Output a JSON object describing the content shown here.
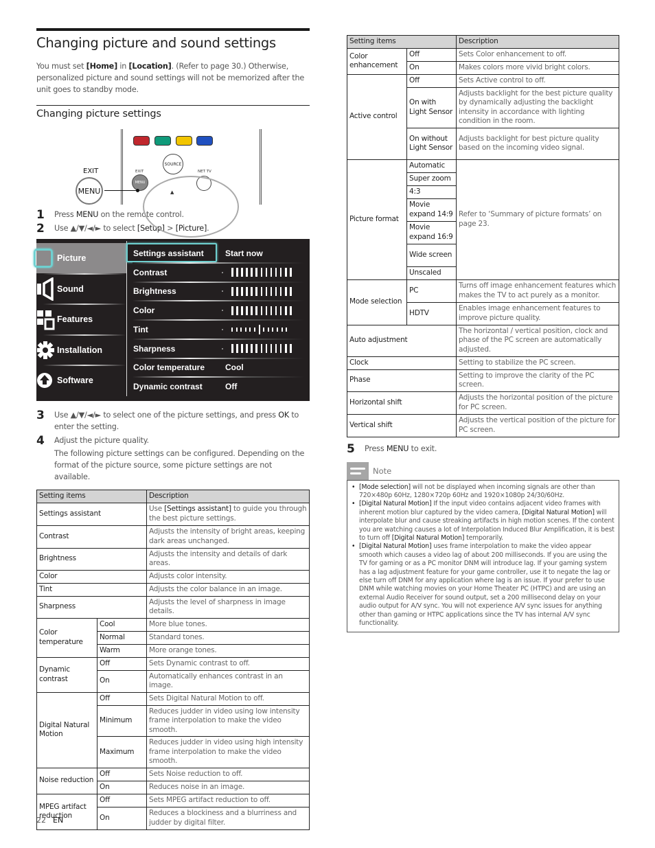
{
  "page": {
    "title": "Changing picture and sound settings",
    "intro": {
      "p1": "You must set ",
      "home": "[Home]",
      "p2": " in ",
      "location": "[Location]",
      "p3": ". (Refer to page 30.) Otherwise, personalized picture and sound settings will not be memorized after the unit goes to standby mode."
    },
    "subtitle": "Changing picture settings"
  },
  "remote": {
    "exit_label": "EXIT",
    "menu_label": "MENU",
    "source_label": "SOURCE",
    "net_tv_label": "NET TV",
    "small_exit_label": "EXIT",
    "small_menu_label": "MENU",
    "up_arrow": "▲",
    "color_buttons": [
      "#c0272d",
      "#0f9a7a",
      "#f2c500",
      "#2050c0"
    ]
  },
  "steps": [
    {
      "num": "1",
      "t1": "Press ",
      "k1": "MENU",
      "t2": " on the remote control."
    },
    {
      "num": "2",
      "t1": "Use ▲/▼/◄/► to select ",
      "k1": "[Setup]",
      "t2": " > ",
      "k2": "[Picture]",
      "t3": "."
    },
    {
      "num": "3",
      "t1": "Use ▲/▼/◄/► to select one of the picture settings, and press ",
      "k1": "OK",
      "t2": " to enter the setting."
    },
    {
      "num": "4",
      "t1": "Adjust the picture quality.",
      "t2": "The following picture settings can be configured. Depending on the format of the picture source, some picture settings are not available."
    },
    {
      "num": "5",
      "t1": "Press ",
      "k1": "MENU",
      "t2": " to exit."
    }
  ],
  "tv_menu": {
    "colors": {
      "background": "#231f20",
      "active": "#8c8a8b",
      "highlight": "#6fd0d0"
    },
    "categories": [
      {
        "label": "Picture",
        "icon": "picture-icon",
        "active": true
      },
      {
        "label": "Sound",
        "icon": "speaker-icon",
        "active": false
      },
      {
        "label": "Features",
        "icon": "features-icon",
        "active": false
      },
      {
        "label": "Installation",
        "icon": "gear-icon",
        "active": false
      },
      {
        "label": "Software",
        "icon": "upload-icon",
        "active": false
      }
    ],
    "items": [
      {
        "label": "Settings assistant",
        "value": "Start now",
        "type": "text"
      },
      {
        "label": "Contrast",
        "type": "slider",
        "level": 1.0
      },
      {
        "label": "Brightness",
        "type": "slider",
        "level": 1.0
      },
      {
        "label": "Color",
        "type": "slider",
        "level": 1.0
      },
      {
        "label": "Tint",
        "type": "tint",
        "level": 0.5
      },
      {
        "label": "Sharpness",
        "type": "slider",
        "level": 1.0
      },
      {
        "label": "Color temperature",
        "value": "Cool",
        "type": "text"
      },
      {
        "label": "Dynamic contrast",
        "value": "Off",
        "type": "text"
      }
    ]
  },
  "table1": {
    "headers": [
      "Setting items",
      "Description"
    ],
    "simple_rows": [
      {
        "item": "Settings assistant",
        "d1": "Use ",
        "dk": "[Settings assistant]",
        "d2": " to guide you through the best picture settings."
      },
      {
        "item": "Contrast",
        "d1": "Adjusts the intensity of bright areas, keeping dark areas unchanged."
      },
      {
        "item": "Brightness",
        "d1": "Adjusts the intensity and details of dark areas."
      },
      {
        "item": "Color",
        "d1": "Adjusts color intensity."
      },
      {
        "item": "Tint",
        "d1": "Adjusts the color balance in an image."
      },
      {
        "item": "Sharpness",
        "d1": "Adjusts the level of sharpness in image details."
      }
    ],
    "color_temperature": {
      "item": "Color temperature",
      "options": [
        {
          "opt": "Cool",
          "desc": "More blue tones."
        },
        {
          "opt": "Normal",
          "desc": "Standard tones."
        },
        {
          "opt": "Warm",
          "desc": "More orange tones."
        }
      ]
    },
    "dynamic_contrast": {
      "item": "Dynamic contrast",
      "options": [
        {
          "opt": "Off",
          "desc": "Sets Dynamic contrast to off."
        },
        {
          "opt": "On",
          "desc": "Automatically enhances contrast in an image."
        }
      ]
    },
    "dnm": {
      "item": "Digital Natural Motion",
      "options": [
        {
          "opt": "Off",
          "desc": "Sets Digital Natural Motion to off."
        },
        {
          "opt": "Minimum",
          "desc": "Reduces judder in video using low intensity frame interpolation to make the video smooth."
        },
        {
          "opt": "Maximum",
          "desc": "Reduces judder in video using high intensity frame interpolation to make the video smooth."
        }
      ]
    },
    "noise": {
      "item": "Noise reduction",
      "options": [
        {
          "opt": "Off",
          "desc": "Sets Noise reduction to off."
        },
        {
          "opt": "On",
          "desc": "Reduces noise in an image."
        }
      ]
    },
    "mpeg": {
      "item": "MPEG artifact reduction",
      "options": [
        {
          "opt": "Off",
          "desc": "Sets MPEG artifact reduction to off."
        },
        {
          "opt": "On",
          "desc": "Reduces a blockiness and a blurriness and judder by digital filter."
        }
      ]
    }
  },
  "table2": {
    "headers": [
      "Setting items",
      "Description"
    ],
    "color_enhancement": {
      "item": "Color enhancement",
      "options": [
        {
          "opt": "Off",
          "desc": "Sets Color enhancement to off."
        },
        {
          "opt": "On",
          "desc": "Makes colors more vivid bright colors."
        }
      ]
    },
    "active_control": {
      "item": "Active control",
      "options": [
        {
          "opt": "Off",
          "desc": "Sets Active control to off."
        },
        {
          "opt": "On with Light Sensor",
          "desc": "Adjusts backlight for the best picture quality by dynamically adjusting the backlight intensity in accordance with lighting condition in the room."
        },
        {
          "opt": "On without Light Sensor",
          "desc": "Adjusts backlight for best picture quality based on the incoming video signal."
        }
      ]
    },
    "picture_format": {
      "item": "Picture format",
      "desc": "Refer to ‘Summary of picture formats’ on page 23.",
      "options": [
        "Automatic",
        "Super zoom",
        "4:3",
        "Movie expand 14:9",
        "Movie expand 16:9",
        "Wide screen",
        "Unscaled"
      ]
    },
    "mode_selection": {
      "item": "Mode selection",
      "options": [
        {
          "opt": "PC",
          "desc": "Turns off image enhancement features which makes the TV to act purely as a monitor."
        },
        {
          "opt": "HDTV",
          "desc": "Enables image enhancement features to improve picture quality."
        }
      ]
    },
    "simple_rows": [
      {
        "item": "Auto adjustment",
        "desc": "The horizontal / vertical position, clock and phase of the PC screen are automatically adjusted."
      },
      {
        "item": "Clock",
        "desc": "Setting to stabilize the PC screen."
      },
      {
        "item": "Phase",
        "desc": "Setting to improve the clarity of the PC screen."
      },
      {
        "item": "Horizontal shift",
        "desc": "Adjusts the horizontal position of the picture for PC screen."
      },
      {
        "item": "Vertical shift",
        "desc": "Adjusts the vertical position of the picture for PC screen."
      }
    ]
  },
  "note": {
    "title": "Note",
    "items": [
      {
        "k1": "[Mode selection]",
        "t1": " will not be displayed when incoming signals are other than 720×480p 60Hz, 1280×720p 60Hz and 1920×1080p 24/30/60Hz."
      },
      {
        "k1": "[Digital Natural Motion]",
        "t1": " If the input video contains adjacent video frames with inherent motion blur captured by the video camera, ",
        "k2": "[Digital Natural Motion]",
        "t2": " will interpolate blur and cause streaking artifacts in high motion scenes. If the content you are watching causes a lot of Interpolation Induced Blur Amplification, it is best to turn off ",
        "k3": "[Digital Natural Motion]",
        "t3": " temporarily."
      },
      {
        "k1": "[Digital Natural Motion]",
        "t1": " uses frame interpolation to make the video appear smooth which causes a video lag of about 200 milliseconds. If you are using the TV for gaming or as a PC monitor DNM will introduce lag. If your gaming system has a lag adjustment feature for your game controller, use it to negate the lag or else turn off DNM for any application where lag is an issue. If your prefer to use DNM while watching movies on your Home Theater PC (HTPC) and are using an external Audio Receiver for sound output, set a 200 millisecond delay on your audio output for A/V sync. You will not experience A/V sync issues for anything other than gaming or HTPC applications since the TV has internal A/V sync functionality."
      }
    ]
  },
  "footer": {
    "page_number": "22",
    "language": "EN"
  }
}
